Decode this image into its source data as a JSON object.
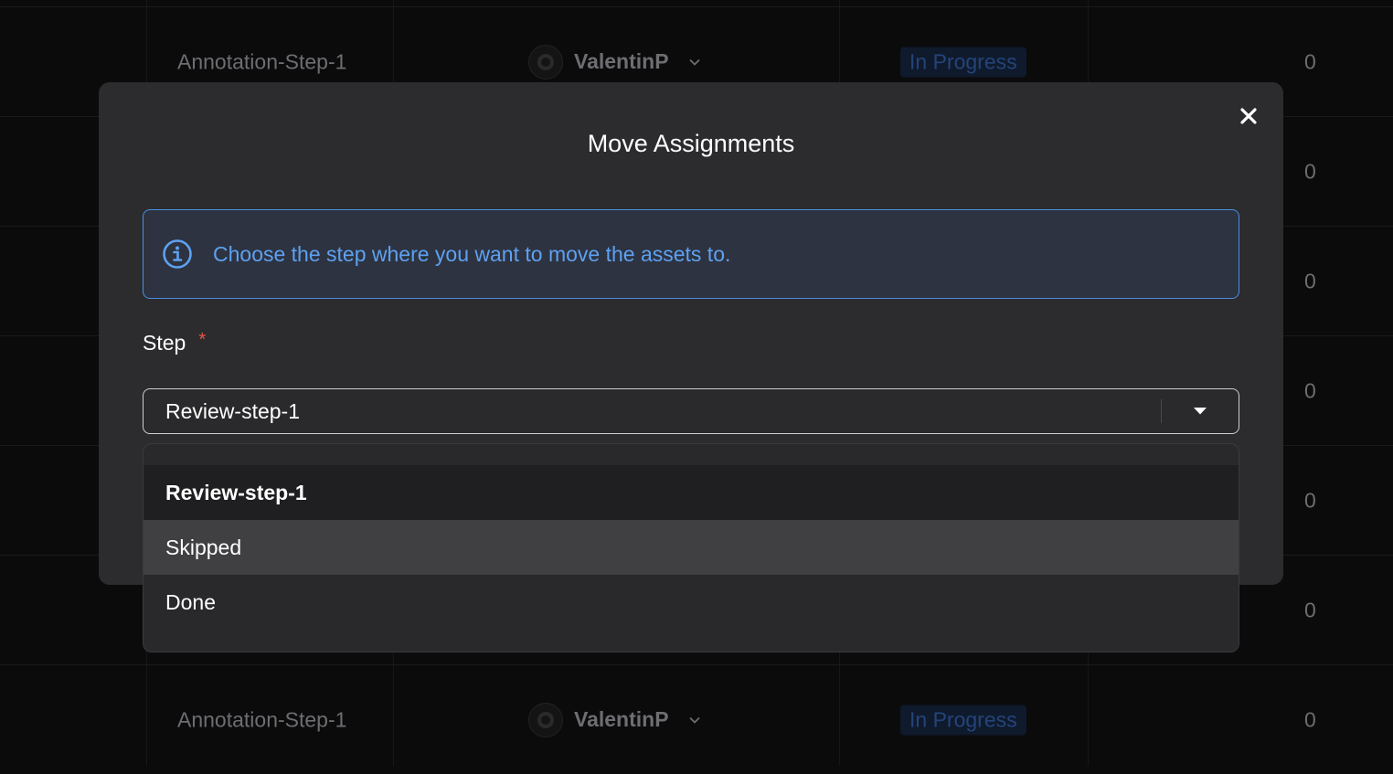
{
  "background_table": {
    "rows": [
      {
        "step": "Annotation-Step-1",
        "user": "ValentinP",
        "status": "In Progress",
        "count": "0"
      },
      {
        "step": "",
        "user": "",
        "status": "",
        "count": "0"
      },
      {
        "step": "",
        "user": "",
        "status": "",
        "count": "0"
      },
      {
        "step": "",
        "user": "",
        "status": "",
        "count": "0"
      },
      {
        "step": "",
        "user": "",
        "status": "",
        "count": "0"
      },
      {
        "step": "",
        "user": "",
        "status": "",
        "count": "0"
      },
      {
        "step": "Annotation-Step-1",
        "user": "ValentinP",
        "status": "In Progress",
        "count": "0"
      }
    ]
  },
  "modal": {
    "title": "Move Assignments",
    "close_icon": "close-icon",
    "info": {
      "icon": "info-icon",
      "text": "Choose the step where you want to move the assets to."
    },
    "step_field": {
      "label": "Step",
      "required_mark": "*",
      "selected_value": "Review-step-1",
      "options": [
        "Review-step-1",
        "Skipped",
        "Done"
      ],
      "highlighted_option": "Skipped"
    }
  },
  "colors": {
    "modal_bg": "#2c2c2e",
    "info_accent": "#5ea1f2",
    "required": "#e8544e",
    "status_text": "#24447a"
  }
}
